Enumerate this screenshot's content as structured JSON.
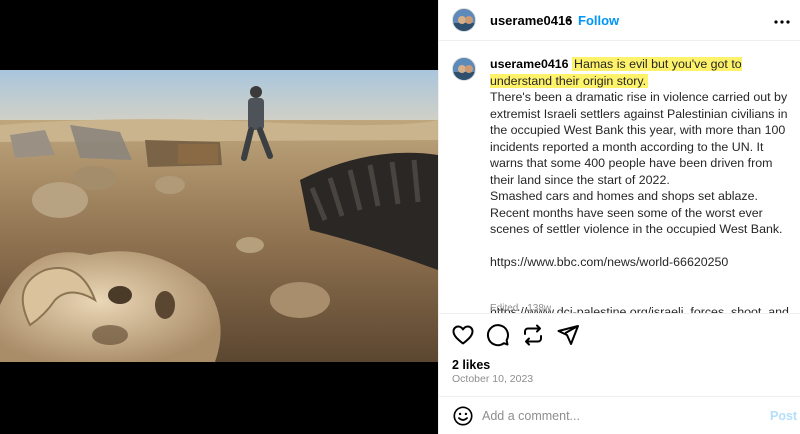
{
  "post": {
    "username": "userame0416",
    "separator": "•",
    "follow_label": "Follow",
    "more_icon": "more-horizontal-icon",
    "caption": {
      "username": "userame0416",
      "highlight": "Hamas is evil but you've got to understand their origin story.",
      "body": "There's been a dramatic rise in violence carried out by extremist Israeli settlers against Palestinian civilians in the occupied West Bank this year, with more than 100 incidents reported a month according to the UN. It warns that some 400 people have been driven from their land since the start of 2022.\nSmashed cars and homes and shops set ablaze. Recent months have seen some of the worst ever scenes of settler violence in the occupied West Bank.",
      "link1": "https://www.bbc.com/news/world-66620250",
      "link2": "https://www.dci-palestine.org/israeli_forces_shoot_and_kill_four_palestinian_boys_in_west_bank",
      "edited": "Edited · 138w"
    },
    "actions": {
      "like_icon": "heart-icon",
      "comment_icon": "comment-icon",
      "repost_icon": "repost-icon",
      "share_icon": "send-icon"
    },
    "likes": "2 likes",
    "date": "October 10, 2023",
    "add_comment": {
      "placeholder": "Add a comment...",
      "post_label": "Post",
      "emoji_icon": "emoji-icon"
    },
    "colors": {
      "accent": "#0095f6",
      "highlight": "#fef26a",
      "post_disabled": "#b2dffc"
    }
  }
}
